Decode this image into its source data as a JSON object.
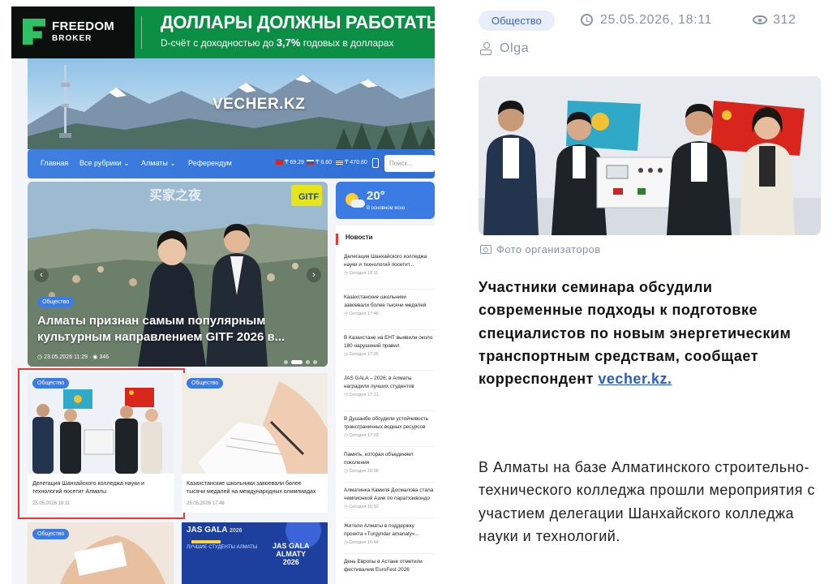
{
  "ad": {
    "logo_line1": "FREEDOM",
    "logo_line2": "BROKER",
    "headline": "ДОЛЛАРЫ ДОЛЖНЫ РАБОТАТЬ",
    "sub_before": "D-счёт с доходностью до ",
    "sub_rate": "3,7%",
    "sub_after": " годовых в долларах",
    "color": "#0a8f45"
  },
  "site": {
    "name": "VECHER.KZ"
  },
  "nav": {
    "items": [
      "Главная",
      "Все рубрики",
      "Алматы",
      "Референдум"
    ],
    "rates": [
      "69.29",
      "6.60",
      "470.80"
    ],
    "search_placeholder": "Поиск...",
    "color": "#3b7be4"
  },
  "hero": {
    "badge": "Общество",
    "sign": "GITF",
    "title": "Алматы признан самым популярным культурным направлением GITF 2026 в...",
    "date": "23.05.2026 11:29",
    "views": "346"
  },
  "weather": {
    "temp": "20°",
    "desc": "В основном ясно"
  },
  "news": {
    "header": "Новости",
    "items": [
      {
        "title_l1": "Делегация Шанхайского колледжа",
        "title_l2": "науки и технологий посетит...",
        "time": "Сегодня 18:11"
      },
      {
        "title_l1": "Казахстанские школьники",
        "title_l2": "завоевали более тысячи медалей",
        "time": "Сегодня 17:48"
      },
      {
        "title_l1": "В Казахстане на ЕНТ выявили около",
        "title_l2": "180 нарушений правил",
        "time": "Сегодня 17:26"
      },
      {
        "title_l1": "JAS GALA – 2026: в Алматы",
        "title_l2": "наградили лучших студентов",
        "time": "Сегодня 17:21"
      },
      {
        "title_l1": "В Душанбе обсудили устойчивость",
        "title_l2": "трансграничных водных ресурсов",
        "time": "Сегодня 17:03"
      },
      {
        "title_l1": "Память, которая объединяет",
        "title_l2": "поколения",
        "time": "Сегодня 16:58"
      },
      {
        "title_l1": "Алматинка Камиля Досмалова стала",
        "title_l2": "чемпионкой Азии по паратхэквондо",
        "time": "Сегодня 16:52"
      },
      {
        "title_l1": "Жители Алматы в поддержку",
        "title_l2": "проекта «Turgyndar amanaty»...",
        "time": "Сегодня 16:44"
      },
      {
        "title_l1": "День Европы в Астане отметили",
        "title_l2": "фестивалем EuroFest 2026",
        "time": ""
      }
    ]
  },
  "cards": [
    {
      "badge": "Общество",
      "title_l1": "Делегация Шанхайского колледжа науки и",
      "title_l2": "технологий посетит Алматы",
      "date": "25.05.2026 18:11"
    },
    {
      "badge": "Общество",
      "title_l1": "Казахстанские школьники завоевали более",
      "title_l2": "тысячи медалей на международных олимпиадах",
      "date": "25.05.2026 17:48"
    },
    {
      "badge": "Общество"
    },
    {
      "badge": "JAS GALA",
      "year": "2026",
      "sub": "ЛУЧШИЕ СТУДЕНТЫ АЛМАТЫ",
      "l1": "JAS GALA",
      "l2": "ALMATY",
      "l3": "2026"
    }
  ],
  "article": {
    "category": "Общество",
    "datetime": "25.05.2026, 18:11",
    "views": "312",
    "author": "Olga",
    "photo_caption": "Фото организаторов",
    "lead_text": "Участники семинара обсудили современные подходы к подготовке специалистов по новым энергетическим транспортным средствам, сообщает корреспондент ",
    "lead_link": "vecher.kz.",
    "body": "В Алматы на базе Алматинского строительно-технического колледжа прошли мероприятия с участием делегации Шанхайского колледжа науки и технологий."
  }
}
